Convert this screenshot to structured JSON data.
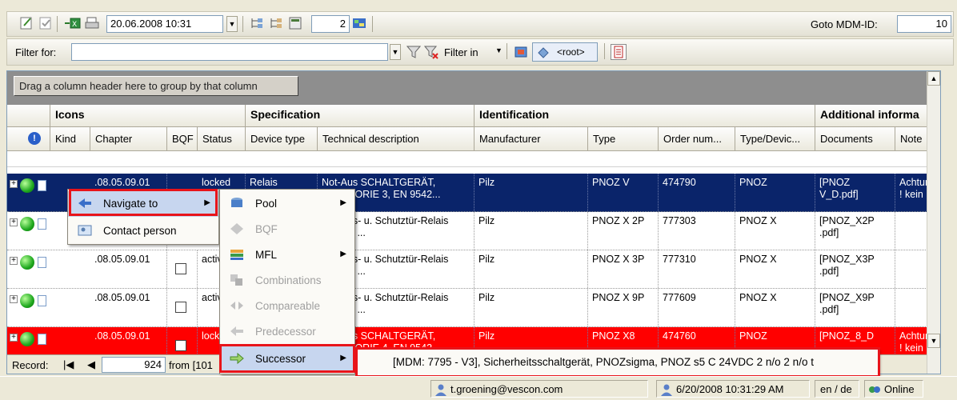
{
  "toolbar1": {
    "datetime_value": "20.06.2008 10:31",
    "number_value": "2",
    "goto_label": "Goto MDM-ID:",
    "goto_value": "10"
  },
  "toolbar2": {
    "filter_label": "Filter for:",
    "filter_value": "",
    "filter_in_label": "Filter in",
    "root_label": "<root>"
  },
  "grid": {
    "group_hint": "Drag a column header here to group by that column",
    "bands": [
      "Icons",
      "Specification",
      "Identification",
      "Additional informa"
    ],
    "columns": [
      "Kind",
      "Chapter",
      "BQF",
      "Status",
      "Device type",
      "Technical description",
      "Manufacturer",
      "Type",
      "Order num...",
      "Type/Devic...",
      "Documents",
      "Note"
    ],
    "rows": [
      {
        "chapter": ".08.05.09.01",
        "status": "locked",
        "device_type": "Relais",
        "tech_desc": "Not-Aus SCHALTGERÄT, KATEGORIE 3, EN 9542...",
        "manufacturer": "Pilz",
        "type": "PNOZ V",
        "order": "474790",
        "type_device": "PNOZ",
        "documents": "[PNOZ V_D.pdf]",
        "note": "Achtung ! kein"
      },
      {
        "chapter": "",
        "status": "",
        "device_type": "",
        "tech_desc": "Not-Aus- u. Schutztür-Relais PNOZx ...",
        "manufacturer": "Pilz",
        "type": "PNOZ X 2P",
        "order": "777303",
        "type_device": "PNOZ X",
        "documents": "[PNOZ_X2P .pdf]",
        "note": ""
      },
      {
        "chapter": ".08.05.09.01",
        "status": "active",
        "device_type": "",
        "tech_desc": "Not-Aus- u. Schutztür-Relais PNOZx ...",
        "manufacturer": "Pilz",
        "type": "PNOZ X 3P",
        "order": "777310",
        "type_device": "PNOZ X",
        "documents": "[PNOZ_X3P .pdf]",
        "note": ""
      },
      {
        "chapter": ".08.05.09.01",
        "status": "active",
        "device_type": "",
        "tech_desc": "Not-Aus- u. Schutztür-Relais PNOZx ...",
        "manufacturer": "Pilz",
        "type": "PNOZ X 9P",
        "order": "777609",
        "type_device": "PNOZ X",
        "documents": "[PNOZ_X9P .pdf]",
        "note": ""
      },
      {
        "chapter": ".08.05.09.01",
        "status": "locked",
        "device_type": "",
        "tech_desc": "Not-Aus SCHALTGERÄT, KATEGORIE 4, EN 9542...",
        "manufacturer": "Pilz",
        "type": "PNOZ X8",
        "order": "474760",
        "type_device": "PNOZ",
        "documents": "[PNOZ_8_D",
        "note": "Achtung ! kein"
      }
    ],
    "record_label": "Record:",
    "record_value": "924",
    "record_from": "from [101"
  },
  "context_menu": {
    "navigate_to": "Navigate to",
    "contact_person": "Contact person"
  },
  "submenu": [
    "Pool",
    "BQF",
    "MFL",
    "Combinations",
    "Compareable",
    "Predecessor",
    "Successor"
  ],
  "successor_tooltip": "[MDM: 7795 - V3], Sicherheitsschaltgerät, PNOZsigma, PNOZ s5 C 24VDC 2 n/o 2 n/o t",
  "statusbar": {
    "user": "t.groening@vescon.com",
    "datetime": "6/20/2008 10:31:29 AM",
    "language": "en / de",
    "connection": "Online"
  },
  "colors": {
    "selected_row": "#0a246a",
    "red_row": "#ff0000",
    "highlight": "#e8141a"
  }
}
